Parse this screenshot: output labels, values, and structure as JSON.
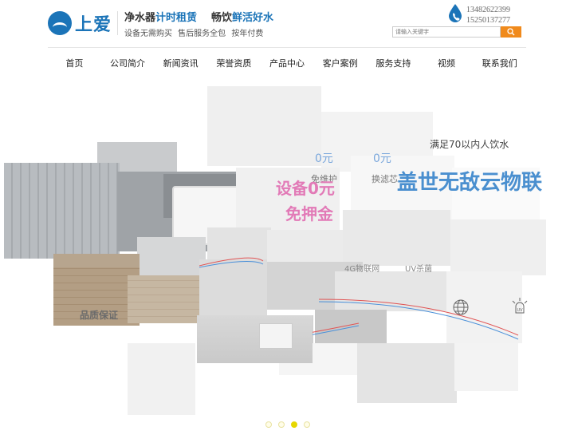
{
  "logo": {
    "text": "上爱"
  },
  "slogan": {
    "part1": "净水器",
    "part2": "计时租赁",
    "part3": "畅饮",
    "part4": "鲜活好水",
    "sub": "设备无需购买 售后服务全包 按年付费"
  },
  "contact": {
    "phone1": "13482622399",
    "phone2": "15250137277"
  },
  "search": {
    "placeholder": "请输入关键字"
  },
  "nav": {
    "items": [
      {
        "label": "首页"
      },
      {
        "label": "公司简介"
      },
      {
        "label": "新闻资讯"
      },
      {
        "label": "荣誉资质"
      },
      {
        "label": "产品中心"
      },
      {
        "label": "客户案例"
      },
      {
        "label": "服务支持"
      },
      {
        "label": "视频"
      },
      {
        "label": "联系我们"
      }
    ]
  },
  "banner": {
    "slogan_top": "满足70以内人饮水",
    "headline": "盖世无敌",
    "headline2": "云物联",
    "promo_main": "设备0元",
    "promo_sub": "免押金",
    "price_a": "0元",
    "price_b": "0元",
    "label_a": "免维护",
    "label_b": "换滤芯",
    "feature_iot": "4G物联网",
    "feature_uv": "UV杀菌",
    "bottom_text": "品质保证"
  },
  "carousel": {
    "count": 4,
    "active_index": 2
  },
  "colors": {
    "brand": "#1b74b8",
    "accent": "#f08a1c",
    "pink": "#e27ab7",
    "dot_active": "#e6d700"
  }
}
